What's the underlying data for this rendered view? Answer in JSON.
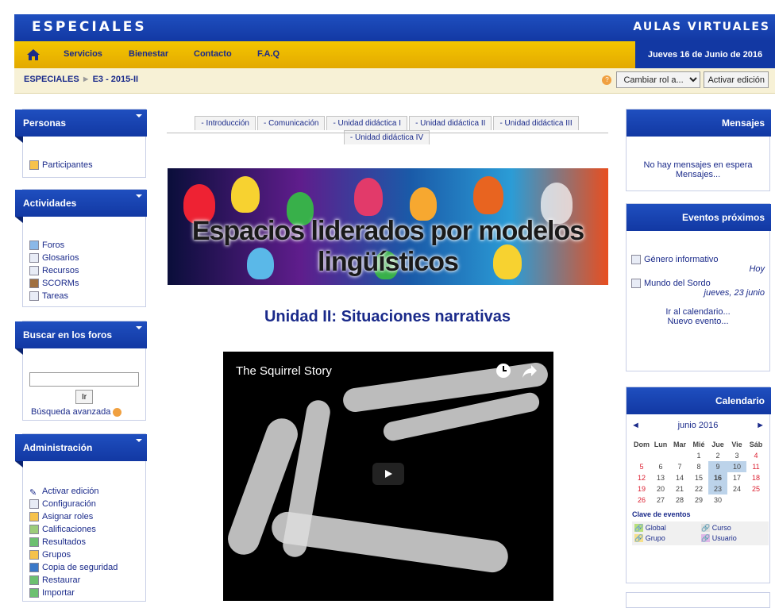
{
  "header": {
    "brand": "ESPECIALES",
    "right": "AULAS VIRTUALES",
    "date": "Jueves 16 de Junio de 2016"
  },
  "nav": [
    "Servicios",
    "Bienestar",
    "Contacto",
    "F.A.Q"
  ],
  "breadcrumb": {
    "root": "ESPECIALES",
    "sep": "►",
    "course": "E3 - 2015-II"
  },
  "controls": {
    "role_select": "Cambiar rol a...",
    "edit_button": "Activar edición"
  },
  "left": {
    "personas": {
      "title": "Personas",
      "items": [
        "Participantes"
      ]
    },
    "actividades": {
      "title": "Actividades",
      "items": [
        "Foros",
        "Glosarios",
        "Recursos",
        "SCORMs",
        "Tareas"
      ]
    },
    "buscar": {
      "title": "Buscar en los foros",
      "button": "Ir",
      "advanced": "Búsqueda avanzada"
    },
    "admin": {
      "title": "Administración",
      "items": [
        "Activar edición",
        "Configuración",
        "Asignar roles",
        "Calificaciones",
        "Resultados",
        "Grupos",
        "Copia de seguridad",
        "Restaurar",
        "Importar"
      ]
    }
  },
  "tabs": [
    "- Introducción",
    "- Comunicación",
    "- Unidad didáctica I",
    "- Unidad didáctica II",
    "- Unidad didáctica III",
    "- Unidad didáctica IV"
  ],
  "banner_text": "Espacios liderados por modelos lingüísticos",
  "heading": "Unidad II: Situaciones narrativas",
  "video_title": "The Squirrel Story",
  "right": {
    "mensajes": {
      "title": "Mensajes",
      "text": "No hay mensajes en espera",
      "link": "Mensajes..."
    },
    "eventos": {
      "title": "Eventos próximos",
      "e1": "Género informativo",
      "e1d": "Hoy",
      "e2": "Mundo del Sordo",
      "e2d": "jueves, 23 junio",
      "l1": "Ir al calendario...",
      "l2": "Nuevo evento..."
    },
    "calendario": {
      "title": "Calendario",
      "month": "junio 2016",
      "days": [
        "Dom",
        "Lun",
        "Mar",
        "Mié",
        "Jue",
        "Vie",
        "Sáb"
      ],
      "clave": "Clave de eventos",
      "keys": [
        "Global",
        "Curso",
        "Grupo",
        "Usuario"
      ]
    }
  }
}
